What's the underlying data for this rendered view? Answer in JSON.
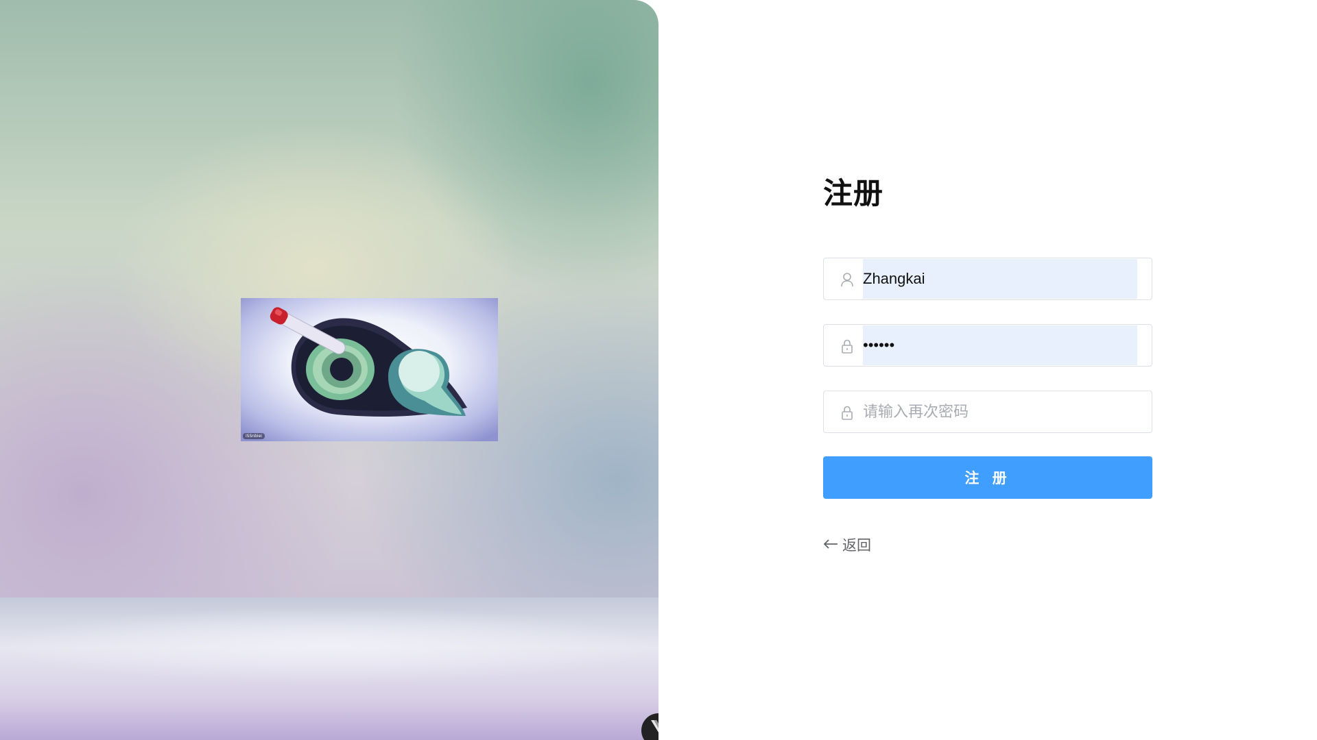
{
  "left": {
    "illustration": {
      "icon": "eye-with-capsule-illustration",
      "watermark_label": "iSSnbiei"
    },
    "vue_badge_icon": "vue-logo-icon"
  },
  "register_form": {
    "title": "注册",
    "username": {
      "value": "Zhangkai",
      "icon": "user-icon"
    },
    "password": {
      "value": "••••••",
      "icon": "lock-icon"
    },
    "confirm_password": {
      "value": "",
      "placeholder": "请输入再次密码",
      "icon": "lock-icon"
    },
    "submit_label": "注 册",
    "back_label": "返回",
    "back_icon": "arrow-left-icon"
  },
  "colors": {
    "primary": "#409eff",
    "autofill_bg": "#e8f0fe",
    "border": "#dcdfe6",
    "link": "#606266"
  }
}
